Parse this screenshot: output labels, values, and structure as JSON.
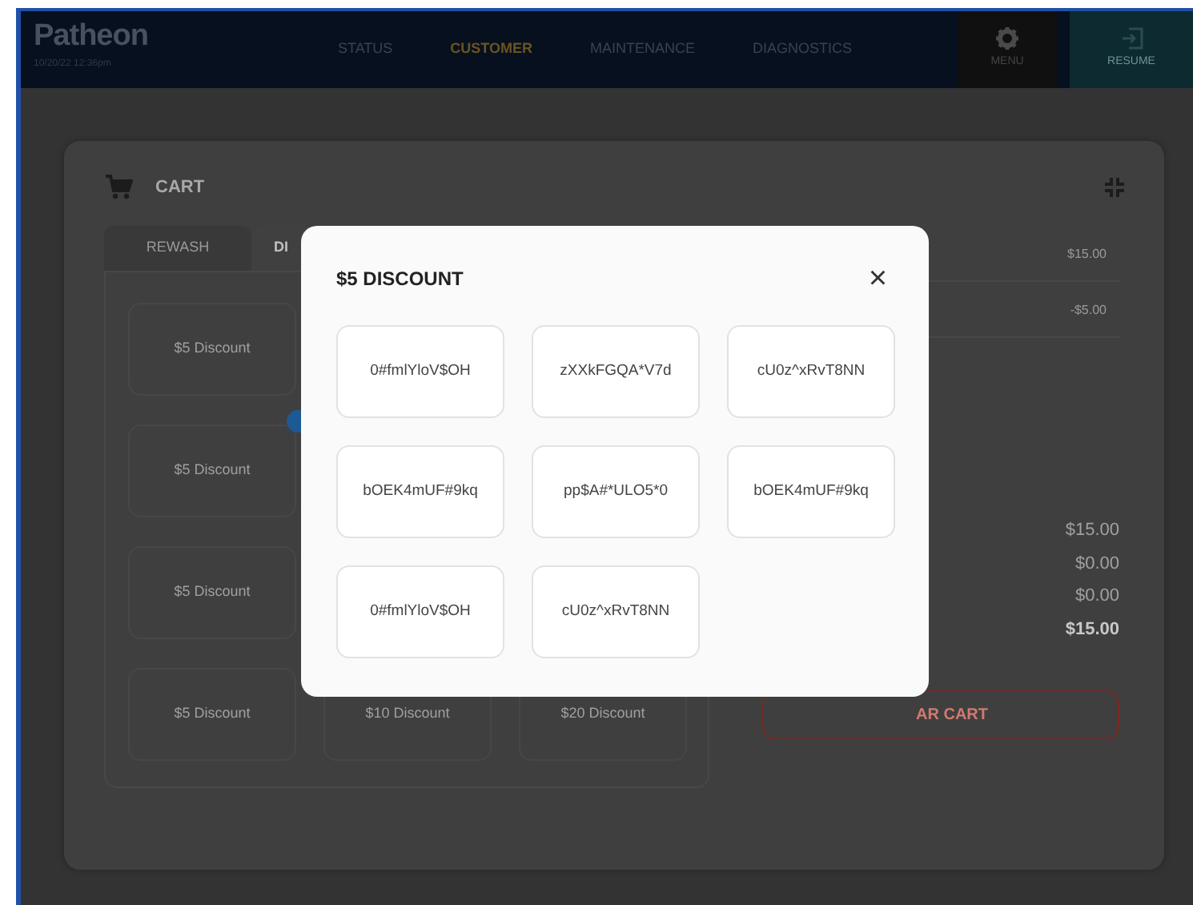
{
  "header": {
    "logo": "Patheon",
    "datetime": "10/20/22 12:36pm",
    "nav": [
      {
        "label": "STATUS",
        "selected": false
      },
      {
        "label": "CUSTOMER",
        "selected": true
      },
      {
        "label": "MAINTENANCE",
        "selected": false
      },
      {
        "label": "DIAGNOSTICS",
        "selected": false
      }
    ],
    "actions": [
      {
        "label": "MENU",
        "kind": "gear"
      },
      {
        "label": "RESUME",
        "kind": "resume"
      }
    ]
  },
  "cart": {
    "title": "CART",
    "tabs": [
      {
        "label": "REWASH",
        "selected": false
      },
      {
        "label": "DI",
        "selected": true
      }
    ],
    "discount_buttons": [
      [
        "$5 Discount"
      ],
      [
        "$5 Discount"
      ],
      [
        "$5 Discount"
      ],
      [
        "$5 Discount",
        "$10 Discount",
        "$20 Discount"
      ]
    ],
    "line_items": [
      "$15.00",
      "-$5.00"
    ],
    "totals": [
      {
        "amount": "$15.00",
        "bold": false
      },
      {
        "amount": "$0.00",
        "bold": false
      },
      {
        "amount": "$0.00",
        "bold": false
      },
      {
        "amount": "$15.00",
        "bold": true
      }
    ],
    "clear_button": "AR CART"
  },
  "modal": {
    "title": "$5 DISCOUNT",
    "close": "×",
    "codes": [
      "0#fmlYloV$OH",
      "zXXkFGQA*V7d",
      "cU0z^xRvT8NN",
      "bOEK4mUF#9kq",
      "pp$A#*ULO5*0",
      "bOEK4mUF#9kq",
      "0#fmlYloV$OH",
      "cU0z^xRvT8NN"
    ]
  }
}
